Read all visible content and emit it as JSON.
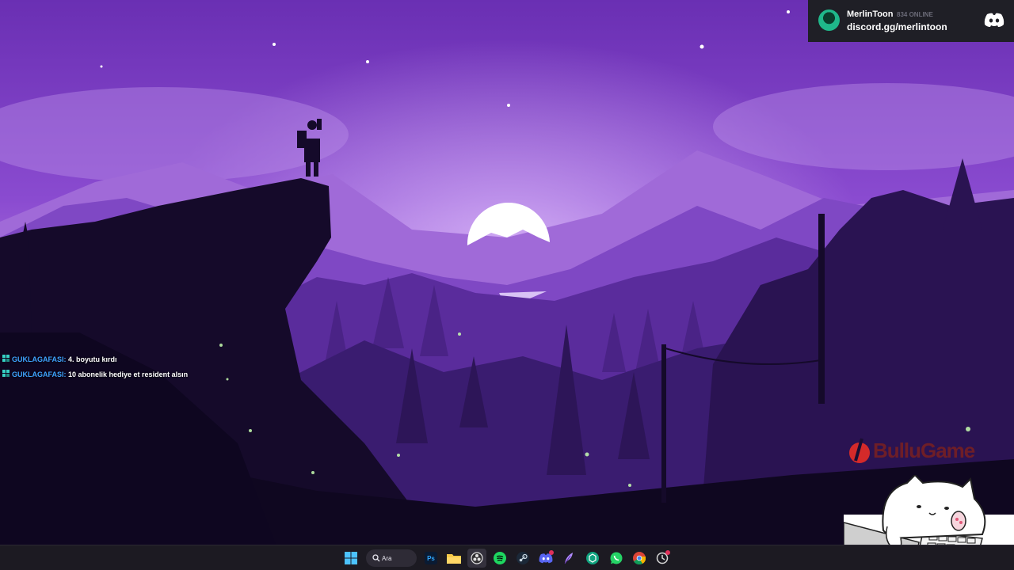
{
  "discord": {
    "username": "MerlinToon",
    "online": "834 ONLINE",
    "invite": "discord.gg/merlintoon"
  },
  "chat": [
    {
      "user": "GUKLAGAFASI:",
      "message": "4. boyutu kırdı"
    },
    {
      "user": "GUKLAGAFASI:",
      "message": "10 abonelik hediye et resident alsın"
    }
  ],
  "sponsor": {
    "text": "BulluGame",
    "color": "#d42a2a"
  },
  "taskbar": {
    "search_label": "Ara",
    "ps_label": "Ps",
    "apps": [
      "windows-start-icon",
      "search",
      "photoshop-icon",
      "file-explorer-icon",
      "obs-icon",
      "spotify-icon",
      "steam-icon",
      "discord-icon",
      "feather-app-icon",
      "chatgpt-icon",
      "whatsapp-icon",
      "chrome-icon",
      "recorder-icon"
    ]
  },
  "colors": {
    "sky": "#7a3fbf",
    "discord_accent": "#5865f2",
    "chat_user": "#3fa3ff",
    "taskbar": "#1c1a22"
  }
}
